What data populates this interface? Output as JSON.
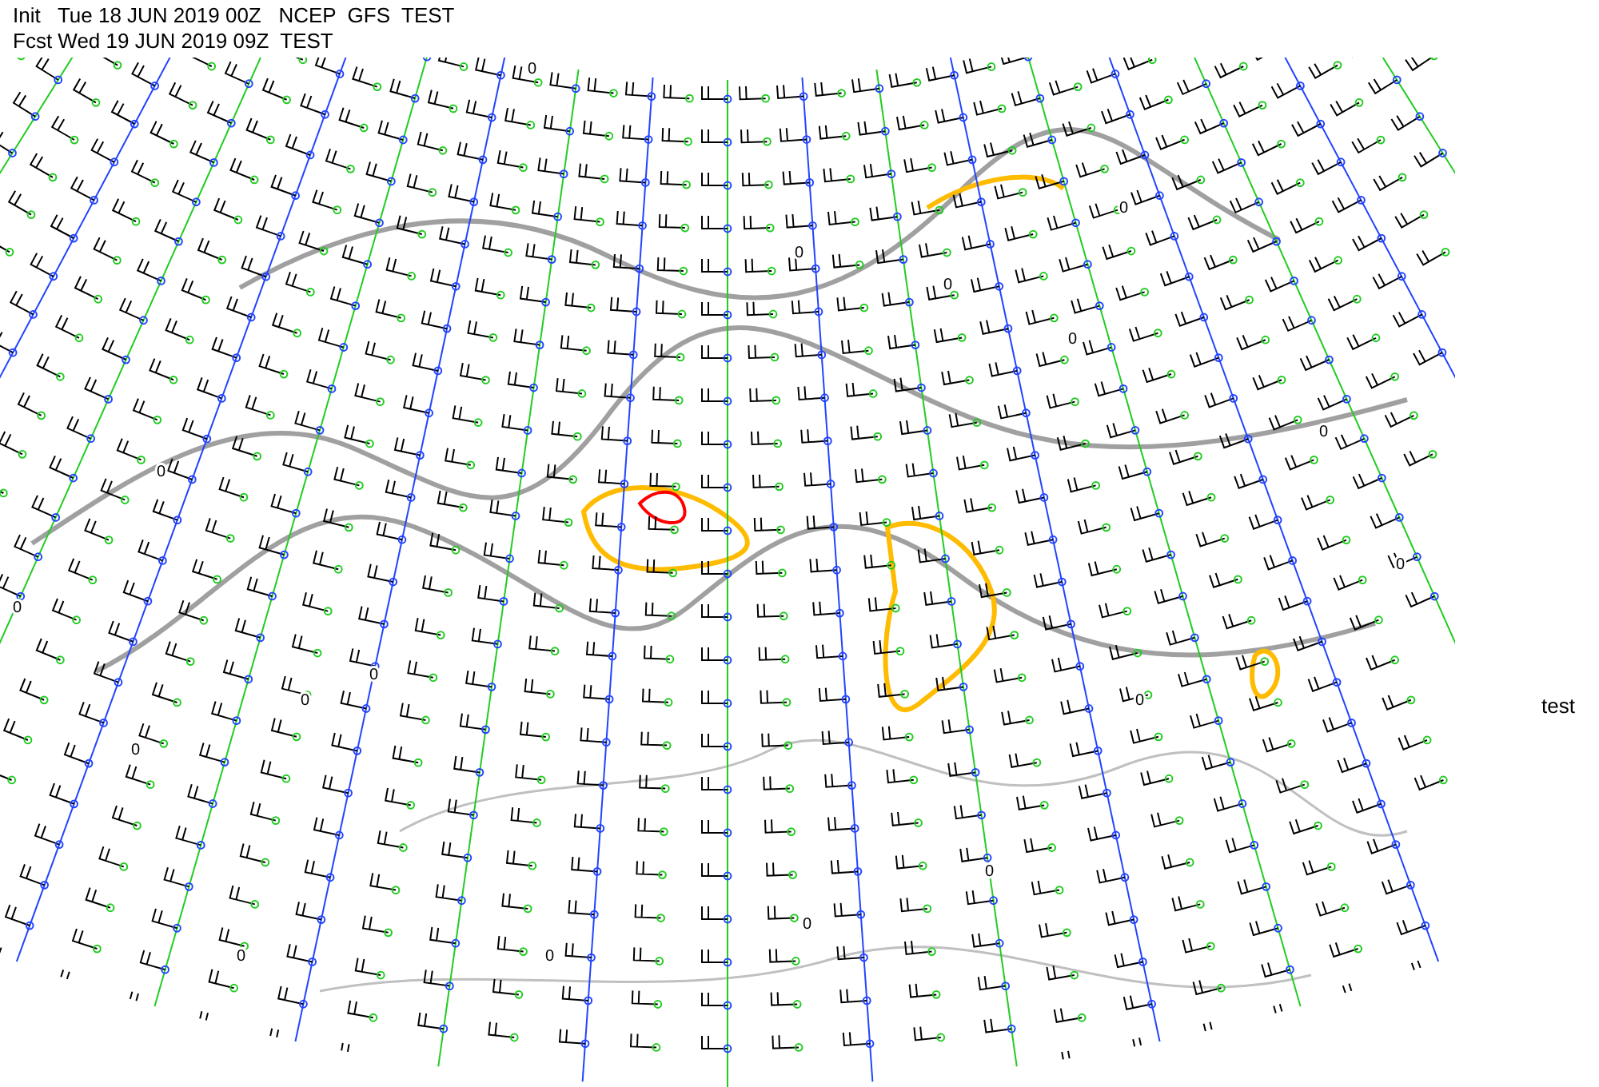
{
  "header": {
    "init_line": "Init   Tue 18 JUN 2019 00Z   NCEP  GFS  TEST",
    "fcst_line": "Fcst Wed 19 JUN 2019 09Z  TEST"
  },
  "side_label": "test",
  "contour_labels": [
    "0",
    "0",
    "0",
    "0",
    "0",
    "0",
    "0",
    "0",
    "0",
    "0",
    "0",
    "0",
    "0",
    "0",
    "0",
    "0",
    "0"
  ]
}
